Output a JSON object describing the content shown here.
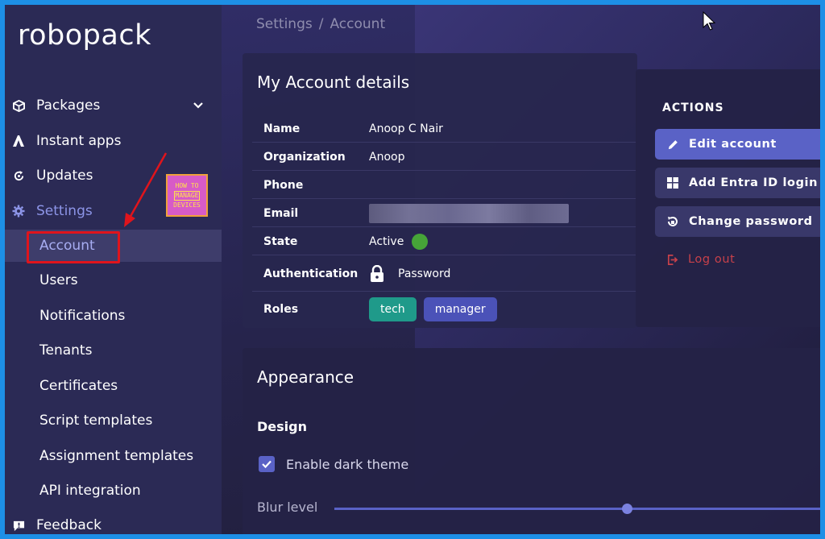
{
  "app": {
    "logo": "robopack"
  },
  "sidebar": {
    "items": [
      {
        "label": "Packages",
        "icon": "package-icon"
      },
      {
        "label": "Instant apps",
        "icon": "instant-apps-icon"
      },
      {
        "label": "Updates",
        "icon": "updates-icon"
      },
      {
        "label": "Settings",
        "icon": "gear-icon"
      }
    ],
    "settings_sub": [
      {
        "label": "Account"
      },
      {
        "label": "Users"
      },
      {
        "label": "Notifications"
      },
      {
        "label": "Tenants"
      },
      {
        "label": "Certificates"
      },
      {
        "label": "Script templates"
      },
      {
        "label": "Assignment templates"
      },
      {
        "label": "API integration"
      }
    ],
    "feedback": "Feedback",
    "watermark": {
      "line1": "HOW TO",
      "line2": "MANAGE",
      "line3": "DEVICES"
    }
  },
  "breadcrumb": {
    "root": "Settings",
    "sep": "/",
    "current": "Account"
  },
  "account": {
    "title": "My Account details",
    "fields": [
      {
        "key": "Name",
        "value": "Anoop C Nair"
      },
      {
        "key": "Organization",
        "value": "Anoop"
      },
      {
        "key": "Phone",
        "value": ""
      },
      {
        "key": "Email",
        "value": ""
      },
      {
        "key": "State",
        "value": "Active"
      },
      {
        "key": "Authentication",
        "value": "Password"
      },
      {
        "key": "Roles",
        "value": ""
      }
    ],
    "roles": [
      "tech",
      "manager"
    ]
  },
  "actions": {
    "title": "ACTIONS",
    "edit": "Edit account",
    "entra": "Add Entra ID login",
    "password": "Change password",
    "logout": "Log out"
  },
  "appearance": {
    "title": "Appearance",
    "design": "Design",
    "dark_theme": "Enable dark theme",
    "dark_theme_checked": true,
    "blur_label": "Blur level",
    "blur_value": 0.58
  },
  "colors": {
    "accent": "#5a62c6",
    "active_green": "#46a438",
    "tech_pill": "#1f9a8a",
    "logout_red": "#c7414a"
  }
}
